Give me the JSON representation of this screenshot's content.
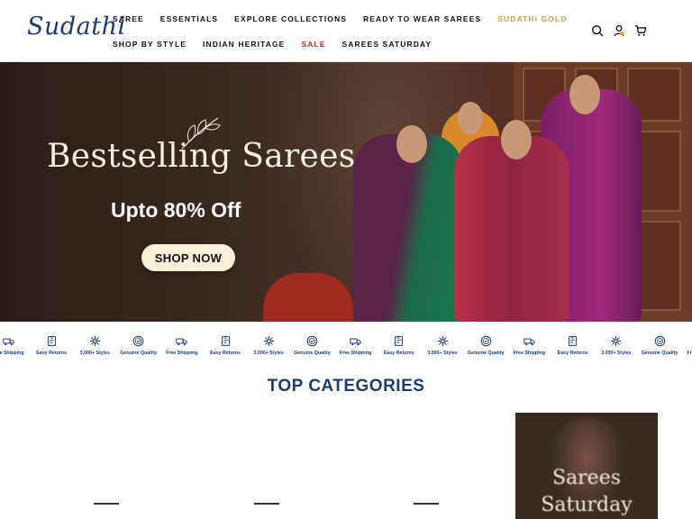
{
  "brand": {
    "logo_text": "Sudathi",
    "accent": "#1d3c6e",
    "gold": "#c9a24a",
    "sale_red": "#c52a2a"
  },
  "nav": {
    "row1": [
      {
        "label": "SAREE",
        "style": "normal"
      },
      {
        "label": "ESSENTIALS",
        "style": "normal"
      },
      {
        "label": "EXPLORE COLLECTIONS",
        "style": "normal"
      },
      {
        "label": "READY TO WEAR SAREES",
        "style": "normal"
      },
      {
        "label": "SUDATHI GOLD",
        "style": "gold"
      }
    ],
    "row2": [
      {
        "label": "SHOP BY STYLE",
        "style": "normal"
      },
      {
        "label": "INDIAN HERITAGE",
        "style": "normal"
      },
      {
        "label": "SALE",
        "style": "sale"
      },
      {
        "label": "SAREES SATURDAY",
        "style": "normal"
      }
    ]
  },
  "header_icons": [
    "search-icon",
    "account-icon",
    "cart-icon"
  ],
  "hero": {
    "title": "Bestselling Sarees",
    "subtitle": "Upto 80% Off",
    "cta": "SHOP NOW"
  },
  "features": [
    "Free Shipping",
    "Easy Returns",
    "3,000+ Styles",
    "Genuine Quality"
  ],
  "categories": {
    "title": "TOP CATEGORIES",
    "card_text_line1": "Sarees",
    "card_text_line2": "Saturday"
  }
}
